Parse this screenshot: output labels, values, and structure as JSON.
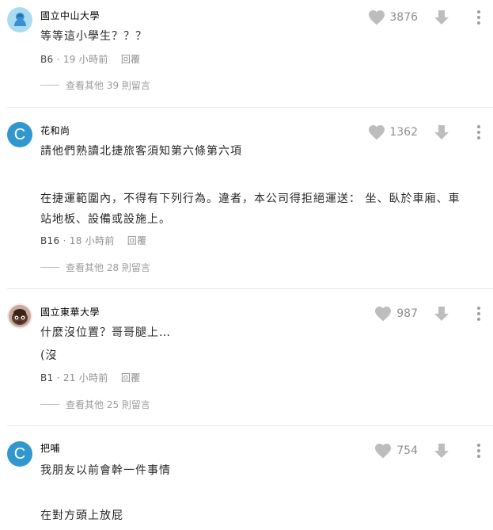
{
  "colors": {
    "avatar_bg": "#3397cf",
    "icon_gray": "#bdbdbd",
    "divider": "#e9e9e9"
  },
  "comments": [
    {
      "author": "國立中山大學",
      "avatar_icon": "person-avatar-icon",
      "lines": [
        "等等這小學生？？？"
      ],
      "floor": "B6",
      "time": "19 小時前",
      "reply_label": "回覆",
      "likes": "3876",
      "more_replies": "查看其他 39 則留言"
    },
    {
      "author": "花和尚",
      "avatar_letter": "C",
      "lines": [
        "請他們熟讀北捷旅客須知第六條第六項",
        "",
        "在捷運範圍內，不得有下列行為。違者，本公司得拒絕運送： 坐、臥於車廂、車",
        "站地板、設備或設施上。"
      ],
      "floor": "B16",
      "time": "18 小時前",
      "reply_label": "回覆",
      "likes": "1362",
      "more_replies": "查看其他 28 則留言"
    },
    {
      "author": "國立東華大學",
      "avatar_icon": "character-avatar-icon",
      "lines": [
        "什麼沒位置？哥哥腿上…",
        "(沒"
      ],
      "floor": "B1",
      "time": "21 小時前",
      "reply_label": "回覆",
      "likes": "987",
      "more_replies": "查看其他 25 則留言"
    },
    {
      "author": "把哺",
      "avatar_letter": "C",
      "lines": [
        "我朋友以前會幹一件事情",
        "",
        "在對方頭上放屁"
      ],
      "likes": "754"
    }
  ]
}
